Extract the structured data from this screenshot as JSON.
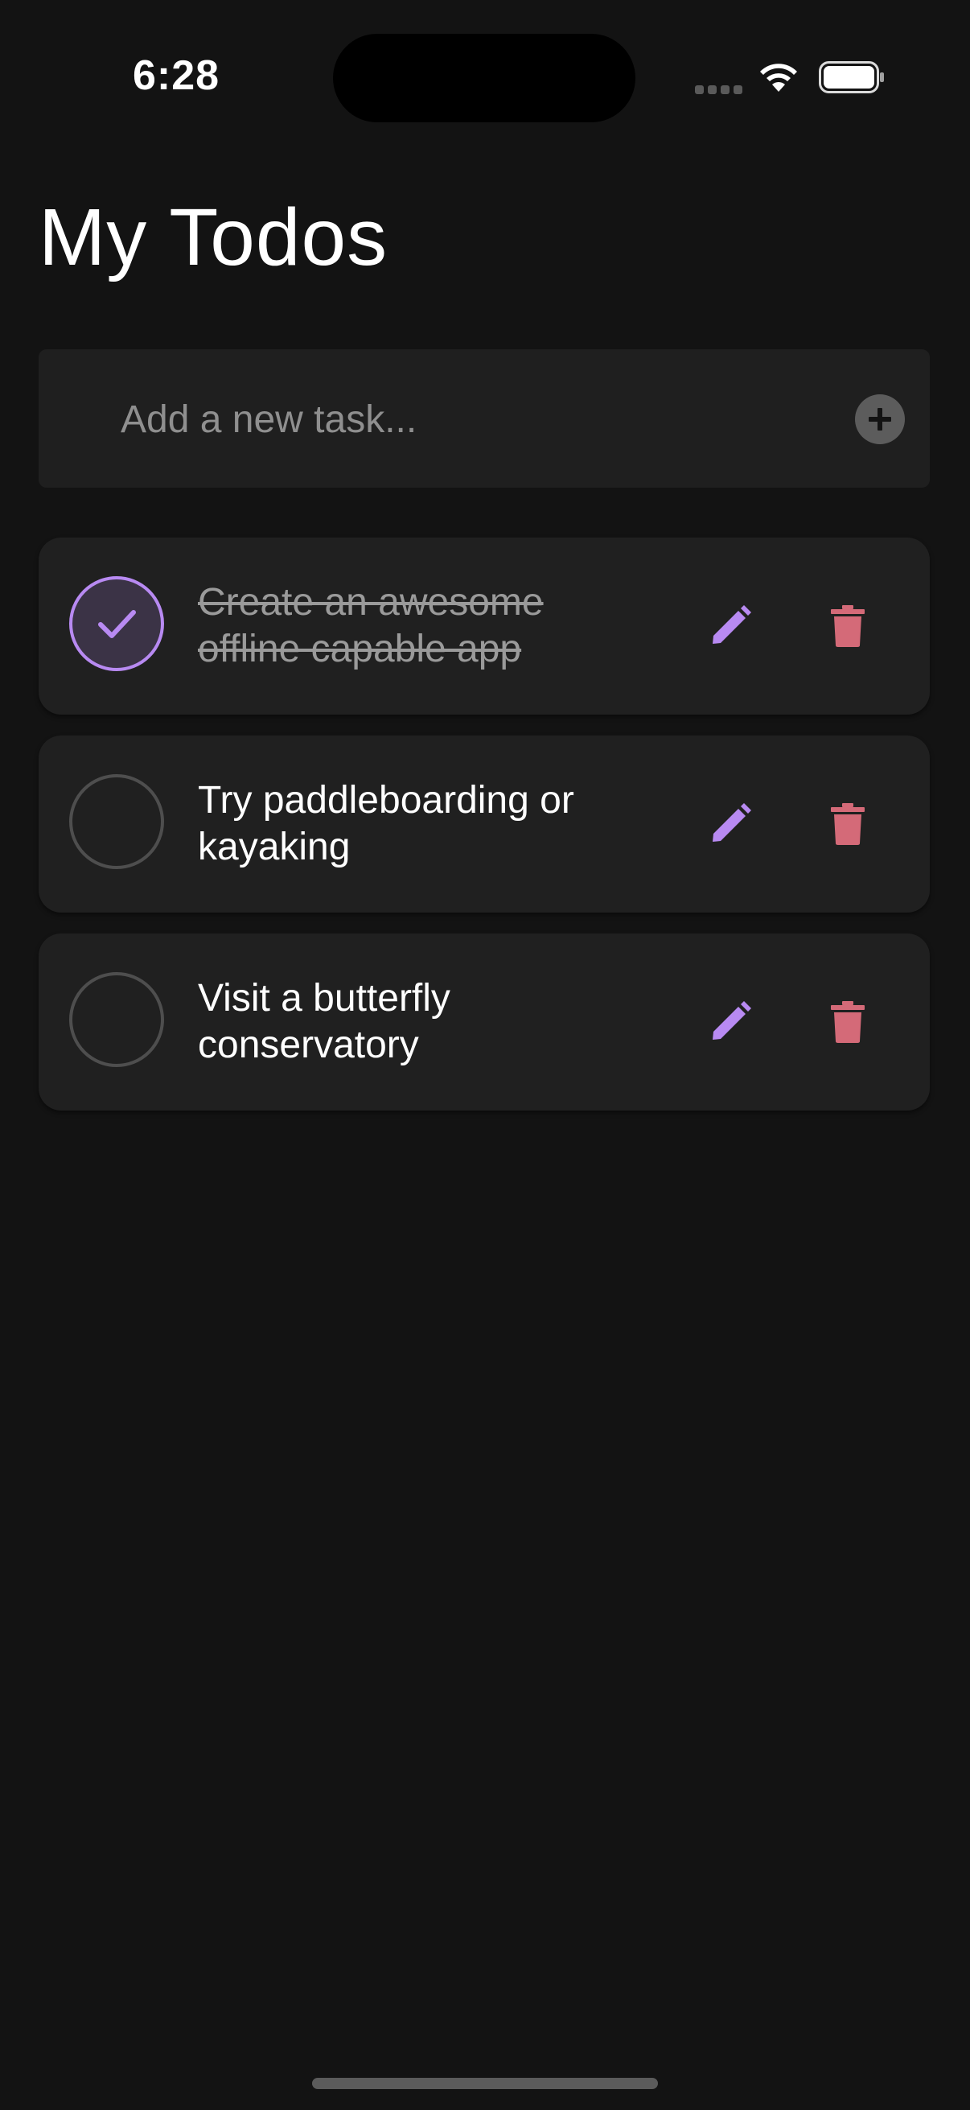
{
  "status_bar": {
    "time": "6:28",
    "icons": [
      "cellular-signal-icon",
      "wifi-icon",
      "battery-icon"
    ]
  },
  "header": {
    "title": "My Todos"
  },
  "add_task": {
    "placeholder": "Add a new task...",
    "value": "",
    "add_icon": "plus-icon"
  },
  "todos": [
    {
      "text": "Create an awesome offline capable app",
      "completed": true
    },
    {
      "text": "Try paddleboarding or kayaking",
      "completed": false
    },
    {
      "text": "Visit a butterfly conservatory",
      "completed": false
    }
  ],
  "item_icons": {
    "edit": "pencil-icon",
    "delete": "trash-icon",
    "done": "checkmark-icon"
  },
  "colors": {
    "background": "#131313",
    "card": "#202020",
    "accent": "#b88af2",
    "delete": "#d46a78",
    "muted_text": "#9a9a9a"
  }
}
